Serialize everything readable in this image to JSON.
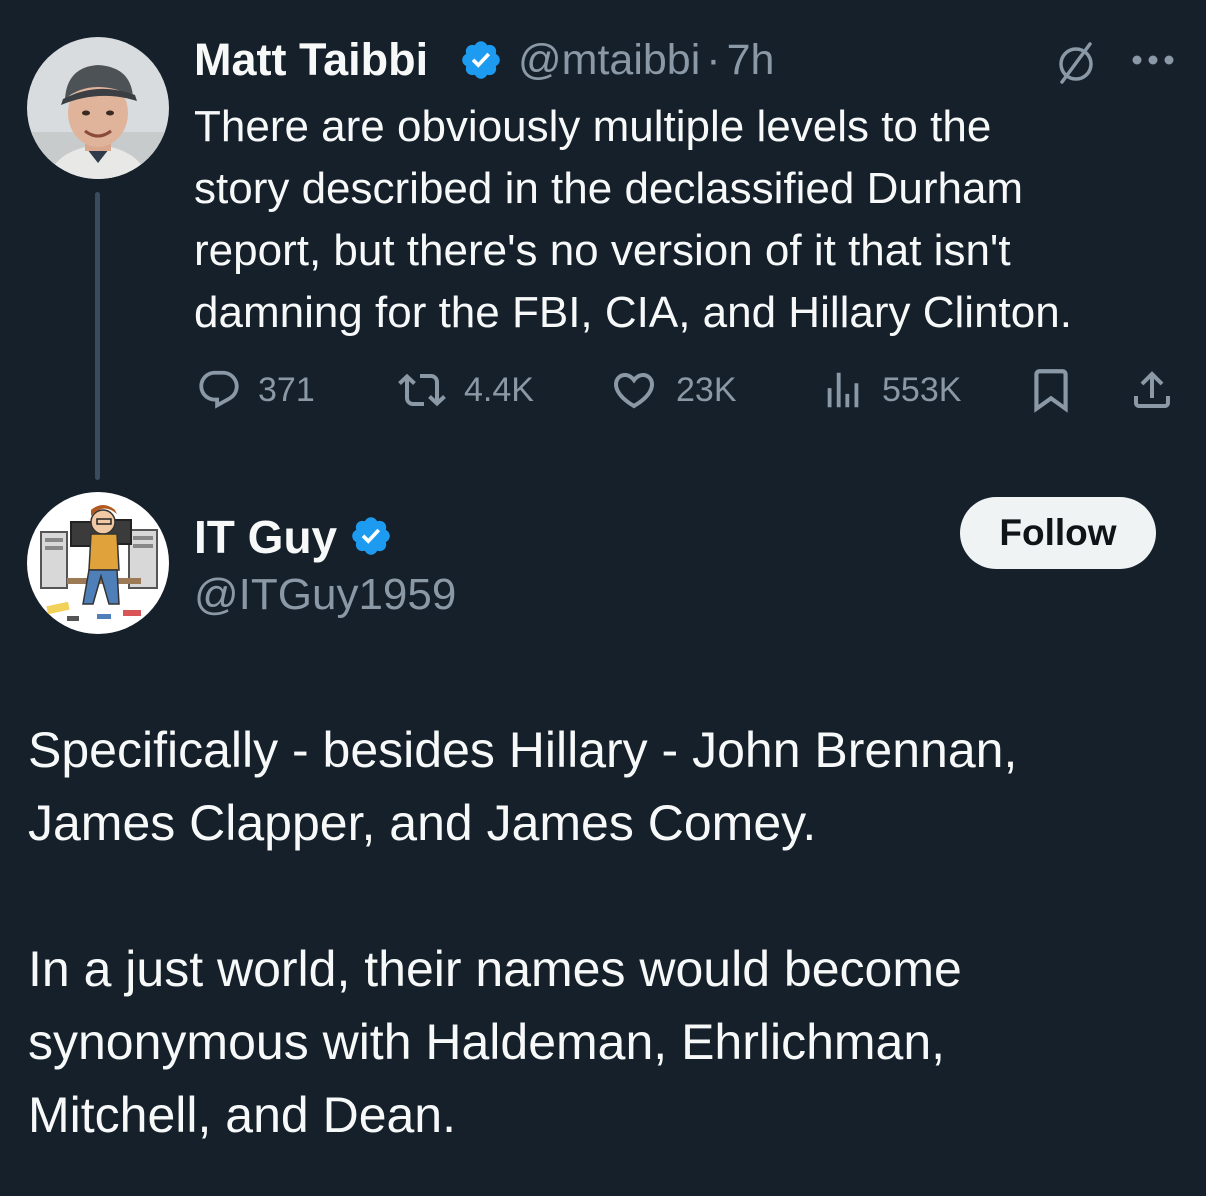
{
  "tweet1": {
    "author_name": "Matt Taibbi",
    "handle": "@mtaibbi",
    "separator": "·",
    "time": "7h",
    "text": "There are obviously multiple levels to the\nstory described in the declassified Durham\nreport, but there's no version of it that isn't\ndamning for the FBI, CIA, and Hillary Clinton.",
    "replies": "371",
    "reposts": "4.4K",
    "likes": "23K",
    "views": "553K",
    "icons": {
      "grok": "slashed-circle-icon",
      "more": "more-dots-icon",
      "reply": "reply-icon",
      "repost": "repost-icon",
      "like": "heart-icon",
      "views": "views-chart-icon",
      "bookmark": "bookmark-icon",
      "share": "share-icon"
    }
  },
  "tweet2": {
    "author_name": "IT Guy",
    "handle": "@ITGuy1959",
    "follow_label": "Follow",
    "paragraphs": [
      "Specifically - besides Hillary - John Brennan,\nJames Clapper, and James Comey.",
      "In a just world, their names would become\nsynonymous with Haldeman, Ehrlichman,\nMitchell, and Dean."
    ]
  },
  "colors": {
    "background": "#15202b",
    "text": "#f7f9f9",
    "muted": "#8b98a5",
    "verified": "#1d9bf0",
    "thread_line": "#3a4b5d",
    "follow_button": "#eff3f4"
  }
}
